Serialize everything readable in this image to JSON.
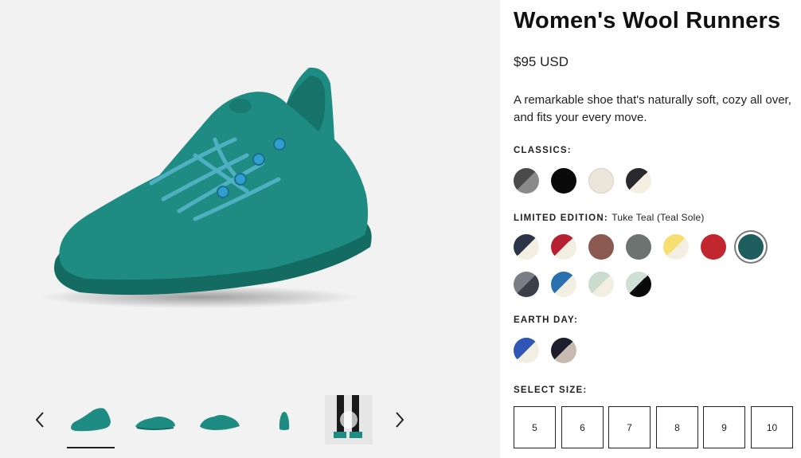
{
  "product": {
    "title": "Women's Wool Runners",
    "price": "$95 USD",
    "description": "A remarkable shoe that's naturally soft, cozy all over, and fits your every move."
  },
  "sections": {
    "classics_label": "CLASSICS:",
    "limited_label": "LIMITED EDITION:",
    "limited_selected": "Tuke Teal (Teal Sole)",
    "earth_day_label": "EARTH DAY:",
    "size_label": "SELECT SIZE:"
  },
  "sizes": [
    "5",
    "6",
    "7",
    "8",
    "9",
    "10"
  ],
  "colors": {
    "shoe_teal": "#1e8c82",
    "shoe_dark": "#136b62",
    "lace_blue": "#3fa7c9",
    "selected_swatch": "#1f5e5e",
    "gallery_bg": "#f2f2f2"
  },
  "gallery": {
    "thumbnails": [
      "shoe-side-view",
      "shoe-pair-view",
      "shoe-pair-angle",
      "shoe-heel-view",
      "model-video"
    ],
    "active_index": 0
  }
}
